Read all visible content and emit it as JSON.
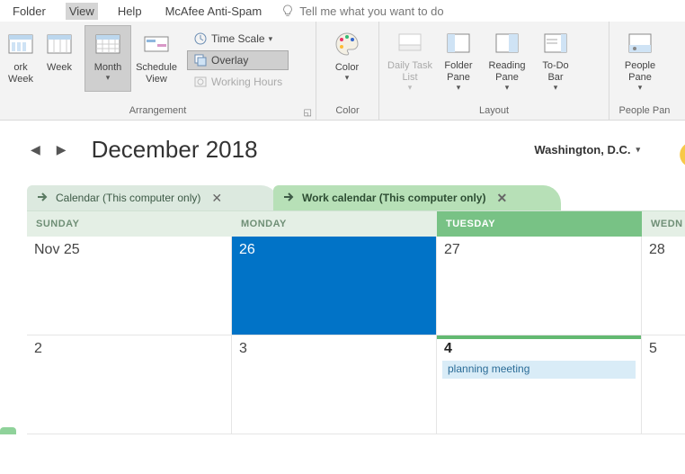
{
  "menu": {
    "folder": "Folder",
    "view": "View",
    "help": "Help",
    "mcafee": "McAfee Anti-Spam",
    "tellme": "Tell me what you want to do"
  },
  "ribbon": {
    "workweek": "ork\nWeek",
    "week": "Week",
    "month": "Month",
    "schedule_view": "Schedule\nView",
    "time_scale": "Time Scale",
    "overlay": "Overlay",
    "working_hours": "Working Hours",
    "color": "Color",
    "daily_task_list": "Daily Task\nList",
    "folder_pane": "Folder\nPane",
    "reading_pane": "Reading\nPane",
    "todo_bar": "To-Do\nBar",
    "people_pane": "People\nPane",
    "group_arrangement": "Arrangement",
    "group_color": "Color",
    "group_layout": "Layout",
    "group_people": "People Pan"
  },
  "calendar": {
    "month_label": "December 2018",
    "location": "Washington,  D.C.",
    "tab1_label": "Calendar (This computer only)",
    "tab2_label": "Work calendar (This computer only)",
    "headers": {
      "sun": "SUNDAY",
      "mon": "MONDAY",
      "tue": "TUESDAY",
      "wed": "WEDN"
    },
    "row1": {
      "sun": "Nov 25",
      "mon": "26",
      "tue": "27",
      "wed": "28"
    },
    "row2": {
      "sun": "2",
      "mon": "3",
      "tue": "4",
      "wed": "5"
    },
    "event": "planning meeting"
  }
}
